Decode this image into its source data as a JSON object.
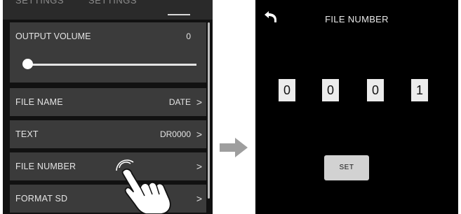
{
  "left_screen": {
    "tabs": [
      {
        "label": "SETTINGS"
      },
      {
        "label": "SETTINGS"
      }
    ],
    "output_volume": {
      "label": "OUTPUT VOLUME",
      "value": "0",
      "level": 0
    },
    "menu_items": [
      {
        "label": "FILE NAME",
        "value": "DATE"
      },
      {
        "label": "TEXT",
        "value": "DR0000"
      },
      {
        "label": "FILE NUMBER",
        "value": ""
      },
      {
        "label": "FORMAT SD",
        "value": ""
      }
    ],
    "chevron": ">"
  },
  "right_screen": {
    "title": "FILE NUMBER",
    "digits": [
      "0",
      "0",
      "0",
      "1"
    ],
    "set_label": "SET"
  },
  "colors": {
    "screen_bg": "#111111",
    "row_bg": "#3b3b3b",
    "arrow": "#9e9e9e"
  },
  "icons": [
    "back-arrow-icon",
    "pointing-hand-icon",
    "right-arrow-icon"
  ]
}
